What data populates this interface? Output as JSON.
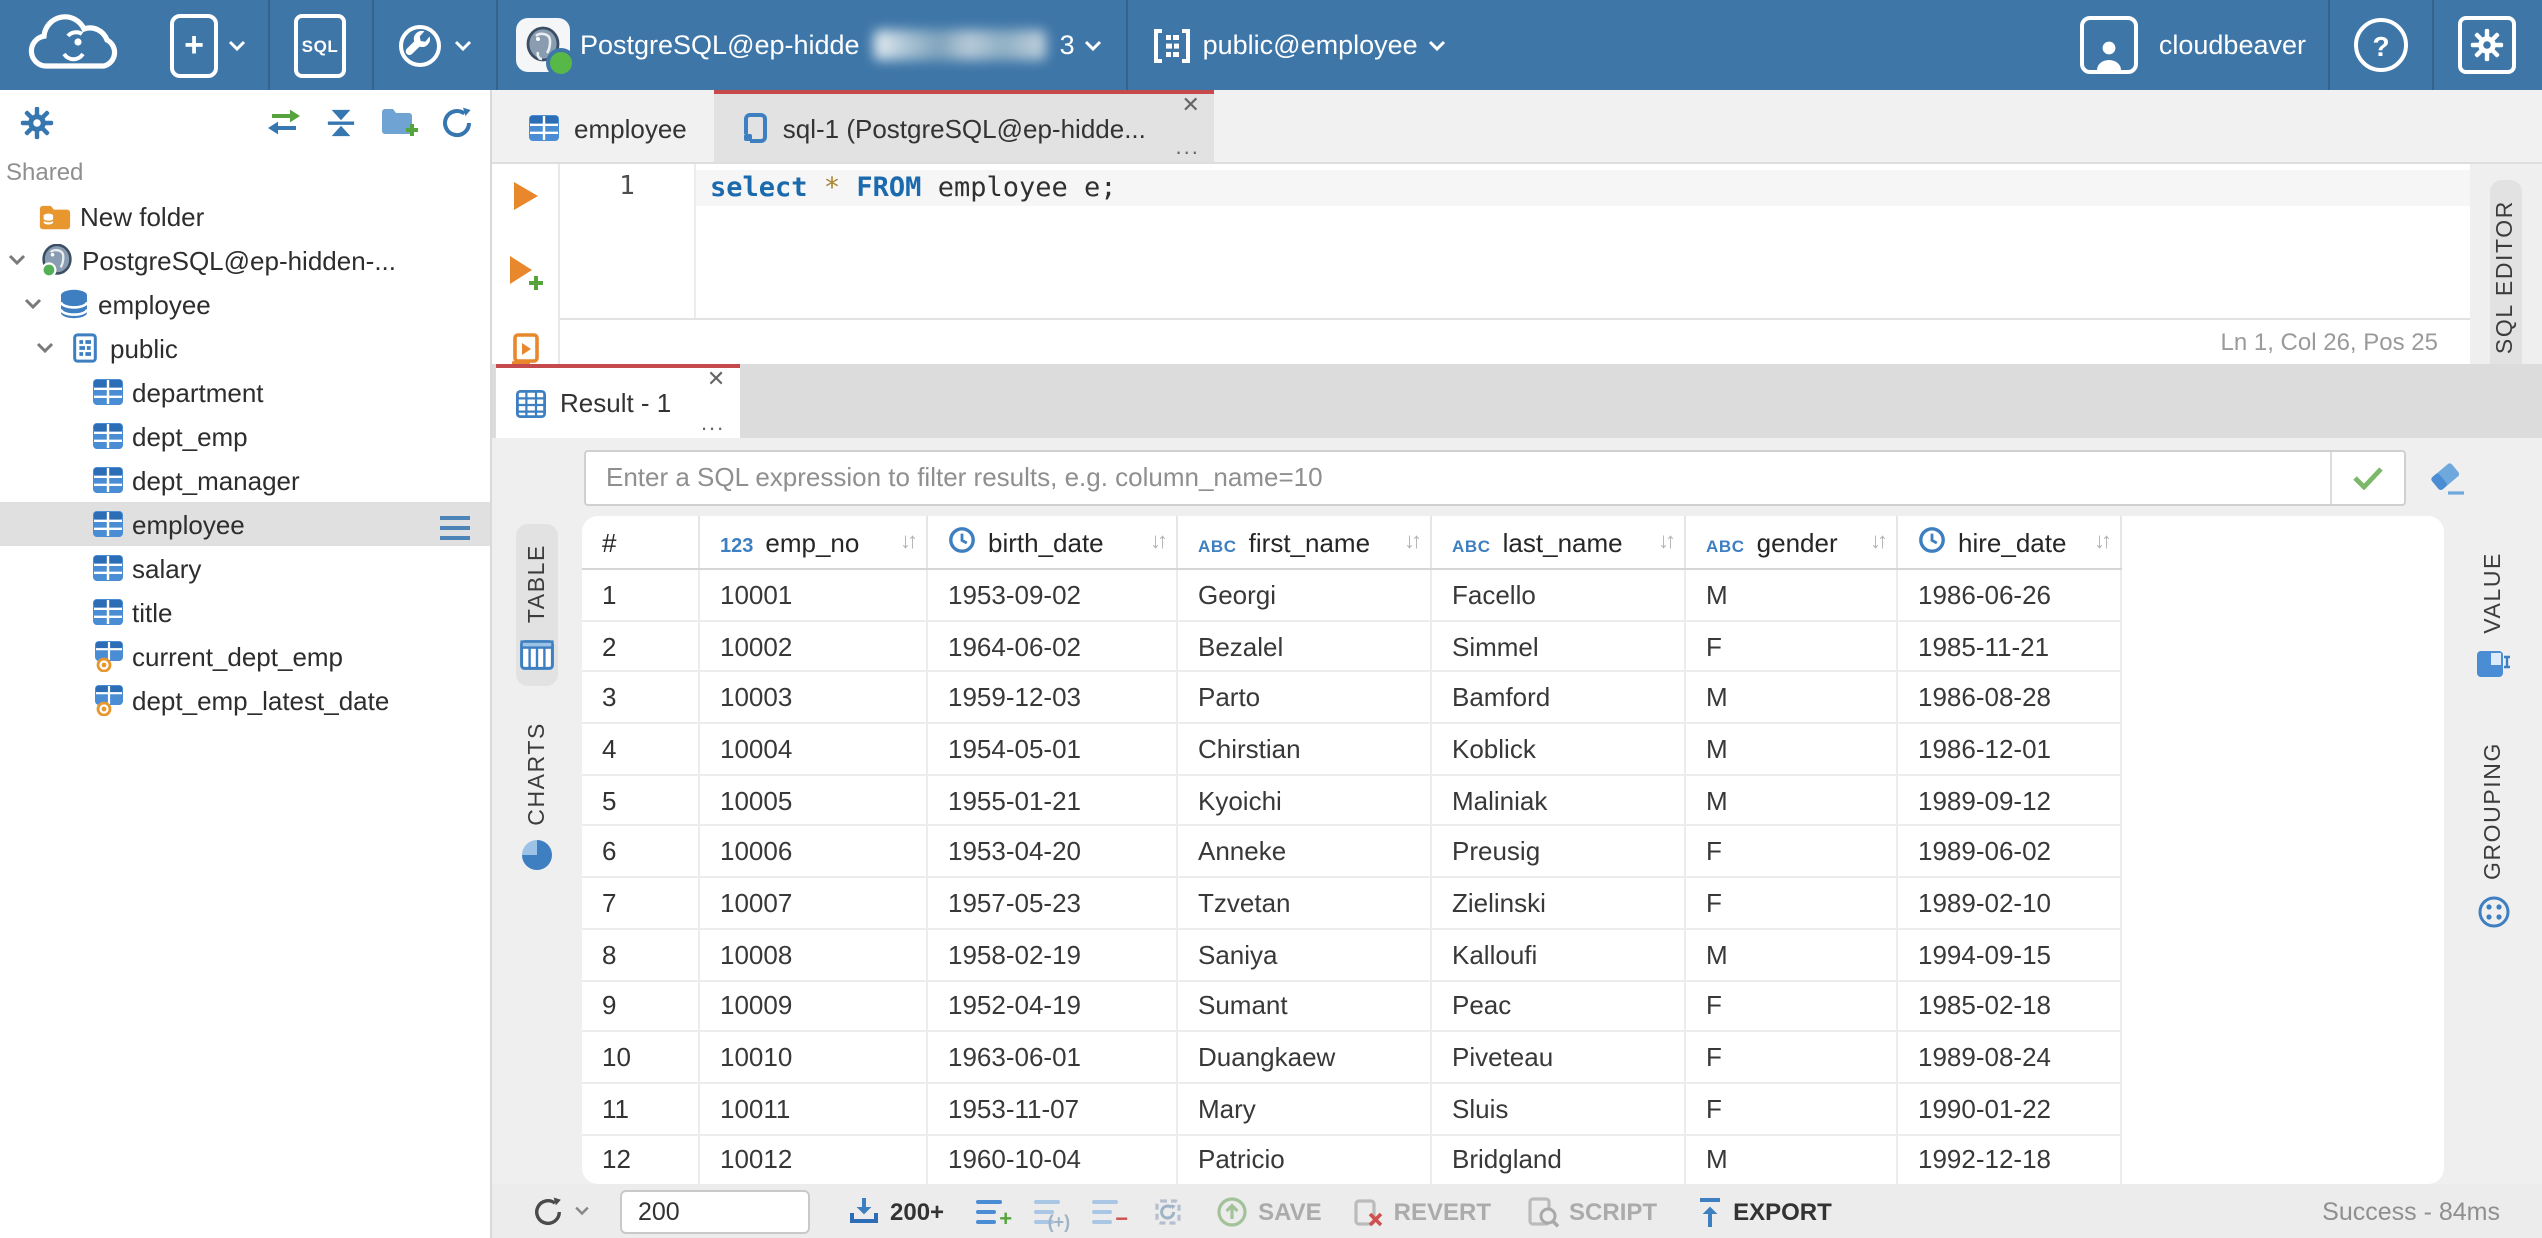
{
  "glyphs": {
    "close": "✕",
    "more": "...",
    "sort": "↓↑",
    "plus": "+",
    "help": "?"
  },
  "topbar": {
    "sql_button_label": "SQL",
    "connection": {
      "name_visible": "PostgreSQL@ep-hidde",
      "masked_tail": "3"
    },
    "schema_selector": "public@employee",
    "user_name": "cloudbeaver"
  },
  "sidebar": {
    "section_label": "Shared",
    "tree": [
      {
        "label": "New folder",
        "icon": "folder-database",
        "pad": 19,
        "chevron": false
      },
      {
        "label": "PostgreSQL@ep-hidden-...",
        "icon": "postgresql",
        "pad": 4,
        "chevron": true
      },
      {
        "label": "employee",
        "icon": "database",
        "pad": 12,
        "chevron": true
      },
      {
        "label": "public",
        "icon": "schema",
        "pad": 18,
        "chevron": true
      },
      {
        "label": "department",
        "icon": "table",
        "pad": 45,
        "chevron": false
      },
      {
        "label": "dept_emp",
        "icon": "table",
        "pad": 45,
        "chevron": false
      },
      {
        "label": "dept_manager",
        "icon": "table",
        "pad": 45,
        "chevron": false
      },
      {
        "label": "employee",
        "icon": "table",
        "pad": 45,
        "chevron": false,
        "selected": true
      },
      {
        "label": "salary",
        "icon": "table",
        "pad": 45,
        "chevron": false
      },
      {
        "label": "title",
        "icon": "table",
        "pad": 45,
        "chevron": false
      },
      {
        "label": "current_dept_emp",
        "icon": "view",
        "pad": 45,
        "chevron": false
      },
      {
        "label": "dept_emp_latest_date",
        "icon": "view",
        "pad": 45,
        "chevron": false
      }
    ]
  },
  "editor": {
    "tabs": {
      "table_tab": "employee",
      "sql_tab": "sql-1 (PostgreSQL@ep-hidde..."
    },
    "line_number": "1",
    "sql": {
      "kw1": "select",
      "star": "*",
      "kw2": "FROM",
      "rest": " employee e;"
    },
    "status": "Ln 1, Col 26, Pos 25",
    "side_tab": "SQL EDITOR"
  },
  "result": {
    "tab_label": "Result - 1",
    "filter_placeholder": "Enter a SQL expression to filter results, e.g. column_name=10",
    "left_tabs": {
      "table": "TABLE",
      "charts": "CHARTS"
    },
    "right_tabs": {
      "value": "VALUE",
      "grouping": "GROUPING"
    },
    "grid": {
      "row_number_header": "#",
      "sort_glyph": "↓↑",
      "columns": [
        {
          "name": "emp_no",
          "type": "123"
        },
        {
          "name": "birth_date",
          "type": "time"
        },
        {
          "name": "first_name",
          "type": "abc"
        },
        {
          "name": "last_name",
          "type": "abc"
        },
        {
          "name": "gender",
          "type": "abc"
        },
        {
          "name": "hire_date",
          "type": "time"
        }
      ],
      "rows": [
        {
          "num": "1",
          "cells": [
            "10001",
            "1953-09-02",
            "Georgi",
            "Facello",
            "M",
            "1986-06-26"
          ]
        },
        {
          "num": "2",
          "cells": [
            "10002",
            "1964-06-02",
            "Bezalel",
            "Simmel",
            "F",
            "1985-11-21"
          ]
        },
        {
          "num": "3",
          "cells": [
            "10003",
            "1959-12-03",
            "Parto",
            "Bamford",
            "M",
            "1986-08-28"
          ]
        },
        {
          "num": "4",
          "cells": [
            "10004",
            "1954-05-01",
            "Chirstian",
            "Koblick",
            "M",
            "1986-12-01"
          ]
        },
        {
          "num": "5",
          "cells": [
            "10005",
            "1955-01-21",
            "Kyoichi",
            "Maliniak",
            "M",
            "1989-09-12"
          ]
        },
        {
          "num": "6",
          "cells": [
            "10006",
            "1953-04-20",
            "Anneke",
            "Preusig",
            "F",
            "1989-06-02"
          ]
        },
        {
          "num": "7",
          "cells": [
            "10007",
            "1957-05-23",
            "Tzvetan",
            "Zielinski",
            "F",
            "1989-02-10"
          ]
        },
        {
          "num": "8",
          "cells": [
            "10008",
            "1958-02-19",
            "Saniya",
            "Kalloufi",
            "M",
            "1994-09-15"
          ]
        },
        {
          "num": "9",
          "cells": [
            "10009",
            "1952-04-19",
            "Sumant",
            "Peac",
            "F",
            "1985-02-18"
          ]
        },
        {
          "num": "10",
          "cells": [
            "10010",
            "1963-06-01",
            "Duangkaew",
            "Piveteau",
            "F",
            "1989-08-24"
          ]
        },
        {
          "num": "11",
          "cells": [
            "10011",
            "1953-11-07",
            "Mary",
            "Sluis",
            "F",
            "1990-01-22"
          ]
        },
        {
          "num": "12",
          "cells": [
            "10012",
            "1960-10-04",
            "Patricio",
            "Bridgland",
            "M",
            "1992-12-18"
          ]
        }
      ]
    },
    "toolbar": {
      "row_limit": "200",
      "fetch_more": "200+",
      "save": "SAVE",
      "revert": "REVERT",
      "script": "SCRIPT",
      "export": "EXPORT"
    },
    "status": "Success - 84ms"
  },
  "colors": {
    "topbar": "#3e76a8",
    "accent_red": "#c6494b",
    "icon_blue": "#3d7fc1",
    "orange": "#e8872b",
    "green": "#57b847",
    "selected_gray": "#e0e0e0"
  }
}
